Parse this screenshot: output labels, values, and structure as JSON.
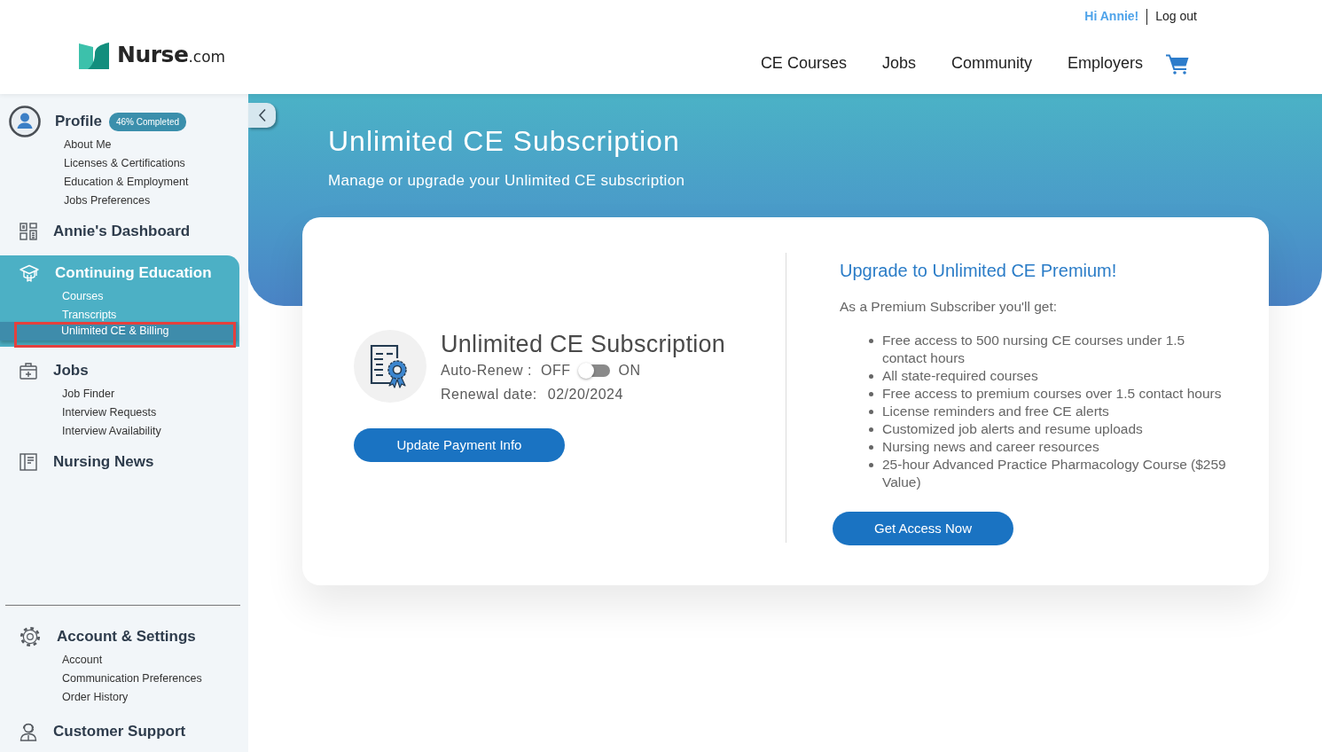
{
  "header": {
    "greeting": "Hi Annie!",
    "logout": "Log out",
    "logo": {
      "name": "Nurse",
      "suffix": ".com"
    },
    "nav": [
      "CE Courses",
      "Jobs",
      "Community",
      "Employers"
    ]
  },
  "sidebar": {
    "sections": [
      {
        "kind": "profile",
        "title": "Profile",
        "badge": "46% Completed",
        "selected": false,
        "items": [
          {
            "label": "About Me",
            "selected": false,
            "highlighted": false
          },
          {
            "label": "Licenses & Certifications",
            "selected": false,
            "highlighted": false
          },
          {
            "label": "Education & Employment",
            "selected": false,
            "highlighted": false
          },
          {
            "label": "Jobs Preferences",
            "selected": false,
            "highlighted": false
          }
        ]
      },
      {
        "kind": "dashboard",
        "title": "Annie's Dashboard",
        "selected": false
      },
      {
        "kind": "education",
        "title": "Continuing Education",
        "selected": true,
        "items": [
          {
            "label": "Courses",
            "selected": false,
            "highlighted": false
          },
          {
            "label": "Transcripts",
            "selected": false,
            "highlighted": false
          },
          {
            "label": "Unlimited CE & Billing",
            "selected": true,
            "highlighted": true
          }
        ]
      },
      {
        "kind": "jobs",
        "title": "Jobs",
        "selected": false,
        "items": [
          {
            "label": "Job Finder",
            "selected": false,
            "highlighted": false
          },
          {
            "label": "Interview Requests",
            "selected": false,
            "highlighted": false
          },
          {
            "label": "Interview Availability",
            "selected": false,
            "highlighted": false
          }
        ]
      },
      {
        "kind": "news",
        "title": "Nursing News",
        "selected": false
      }
    ],
    "footer_sections": [
      {
        "kind": "settings",
        "title": "Account & Settings",
        "selected": false,
        "items": [
          {
            "label": "Account",
            "selected": false,
            "highlighted": false
          },
          {
            "label": "Communication Preferences",
            "selected": false,
            "highlighted": false
          },
          {
            "label": "Order History",
            "selected": false,
            "highlighted": false
          }
        ]
      },
      {
        "kind": "support",
        "title": "Customer Support",
        "selected": false
      }
    ]
  },
  "hero": {
    "title": "Unlimited CE Subscription",
    "subtitle": "Manage or upgrade your Unlimited CE subscription"
  },
  "subscription": {
    "title": "Unlimited CE Subscription",
    "auto_renew": {
      "label": "Auto-Renew :",
      "off_label": "OFF",
      "on_label": "ON",
      "on": false
    },
    "renewal_label": "Renewal date:",
    "renewal_date": "02/20/2024",
    "button": "Update Payment Info"
  },
  "upgrade": {
    "title": "Upgrade to Unlimited CE Premium!",
    "intro": "As a Premium Subscriber you'll get:",
    "benefits": [
      "Free access to 500 nursing CE courses under 1.5 contact hours",
      "All state-required courses",
      "Free access to premium courses over 1.5 contact hours",
      "License reminders and free CE alerts",
      "Customized job alerts and resume uploads",
      "Nursing news and career resources",
      "25-hour Advanced Practice Pharmacology Course ($259 Value)"
    ],
    "button": "Get Access Now"
  }
}
